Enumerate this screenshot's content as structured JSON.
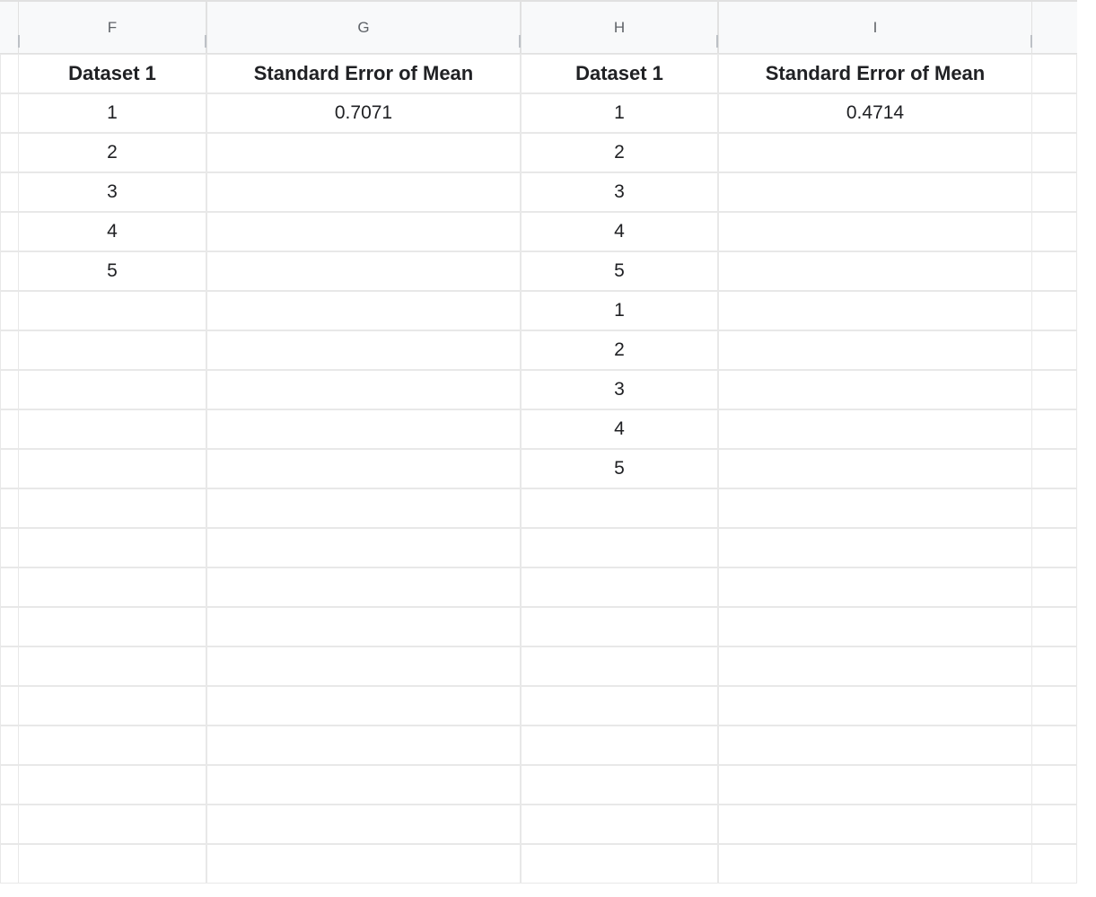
{
  "columns": {
    "stubLeft": "",
    "F": "F",
    "G": "G",
    "H": "H",
    "I": "I",
    "stubRight": ""
  },
  "headerRow": {
    "F": "Dataset 1",
    "G": "Standard Error of Mean",
    "H": "Dataset 1",
    "I": "Standard Error of Mean"
  },
  "rows": [
    {
      "F": "1",
      "G": "0.7071",
      "H": "1",
      "I": "0.4714"
    },
    {
      "F": "2",
      "G": "",
      "H": "2",
      "I": ""
    },
    {
      "F": "3",
      "G": "",
      "H": "3",
      "I": ""
    },
    {
      "F": "4",
      "G": "",
      "H": "4",
      "I": ""
    },
    {
      "F": "5",
      "G": "",
      "H": "5",
      "I": ""
    },
    {
      "F": "",
      "G": "",
      "H": "1",
      "I": ""
    },
    {
      "F": "",
      "G": "",
      "H": "2",
      "I": ""
    },
    {
      "F": "",
      "G": "",
      "H": "3",
      "I": ""
    },
    {
      "F": "",
      "G": "",
      "H": "4",
      "I": ""
    },
    {
      "F": "",
      "G": "",
      "H": "5",
      "I": ""
    },
    {
      "F": "",
      "G": "",
      "H": "",
      "I": ""
    },
    {
      "F": "",
      "G": "",
      "H": "",
      "I": ""
    },
    {
      "F": "",
      "G": "",
      "H": "",
      "I": ""
    },
    {
      "F": "",
      "G": "",
      "H": "",
      "I": ""
    },
    {
      "F": "",
      "G": "",
      "H": "",
      "I": ""
    },
    {
      "F": "",
      "G": "",
      "H": "",
      "I": ""
    },
    {
      "F": "",
      "G": "",
      "H": "",
      "I": ""
    },
    {
      "F": "",
      "G": "",
      "H": "",
      "I": ""
    },
    {
      "F": "",
      "G": "",
      "H": "",
      "I": ""
    },
    {
      "F": "",
      "G": "",
      "H": "",
      "I": ""
    }
  ]
}
